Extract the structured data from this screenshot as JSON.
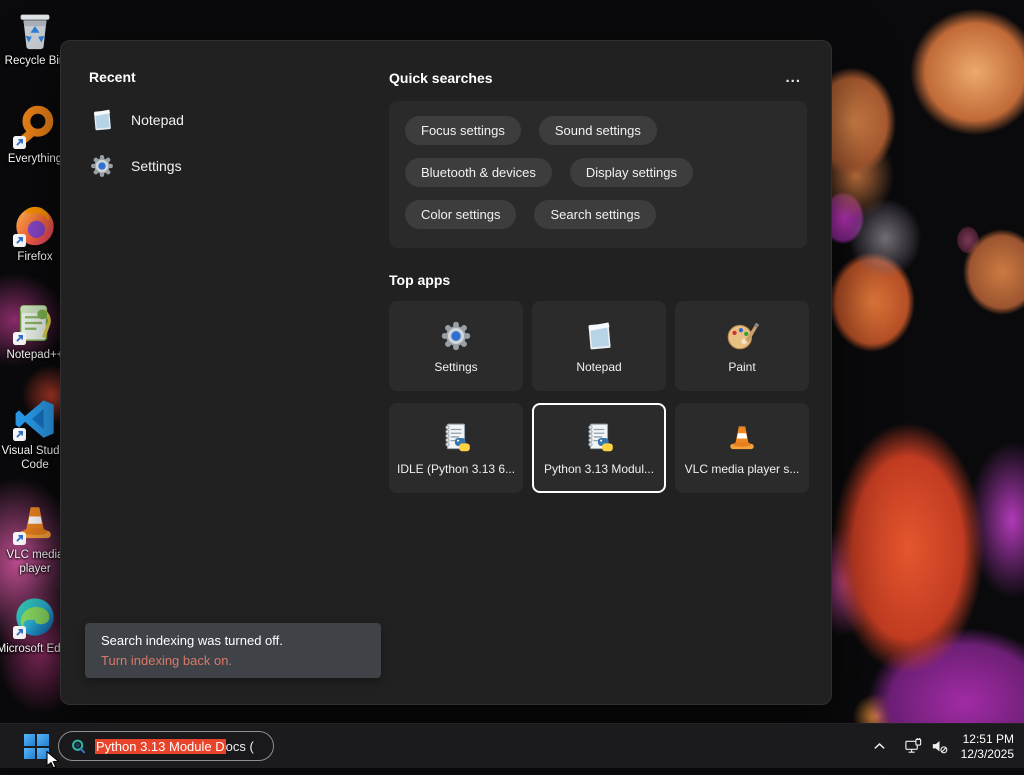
{
  "desktop": {
    "icons": [
      {
        "label": "Recycle Bin"
      },
      {
        "label": "Everything"
      },
      {
        "label": "Firefox"
      },
      {
        "label": "Notepad++"
      },
      {
        "label": "Visual Studio Code"
      },
      {
        "label": "VLC media player"
      },
      {
        "label": "Microsoft Edge"
      }
    ]
  },
  "panel": {
    "recent": {
      "title": "Recent",
      "items": [
        {
          "label": "Notepad",
          "icon": "notepad-icon"
        },
        {
          "label": "Settings",
          "icon": "gear-icon"
        }
      ]
    },
    "quick_searches": {
      "title": "Quick searches",
      "more_label": "...",
      "pills": [
        "Focus settings",
        "Sound settings",
        "Bluetooth & devices",
        "Display settings",
        "Color settings",
        "Search settings"
      ]
    },
    "top_apps": {
      "title": "Top apps",
      "tiles": [
        {
          "label": "Settings",
          "icon": "gear-icon",
          "selected": false
        },
        {
          "label": "Notepad",
          "icon": "notepad-icon",
          "selected": false
        },
        {
          "label": "Paint",
          "icon": "paint-icon",
          "selected": false
        },
        {
          "label": "IDLE (Python 3.13 6...",
          "icon": "python-doc-icon",
          "selected": false
        },
        {
          "label": "Python 3.13 Modul...",
          "icon": "python-doc-icon",
          "selected": true
        },
        {
          "label": "VLC media player s...",
          "icon": "vlc-cone-icon",
          "selected": false
        }
      ]
    },
    "notice": {
      "message": "Search indexing was turned off.",
      "action": "Turn indexing back on."
    }
  },
  "taskbar": {
    "search": {
      "icon": "search-icon",
      "selected_text": "Python 3.13 Module D",
      "rest_text": "ocs ("
    },
    "tray": {
      "icons": [
        "chevron-up-icon",
        "network-icon",
        "volume-muted-icon"
      ],
      "time": "12:51 PM",
      "date": "12/3/2025"
    }
  },
  "colors": {
    "selection_highlight": "#e8442b",
    "notice_link": "#d9796a",
    "start_blue": "#3b9cf1",
    "panel_bg": "#212121",
    "taskbar_bg": "#1b1b1d"
  }
}
